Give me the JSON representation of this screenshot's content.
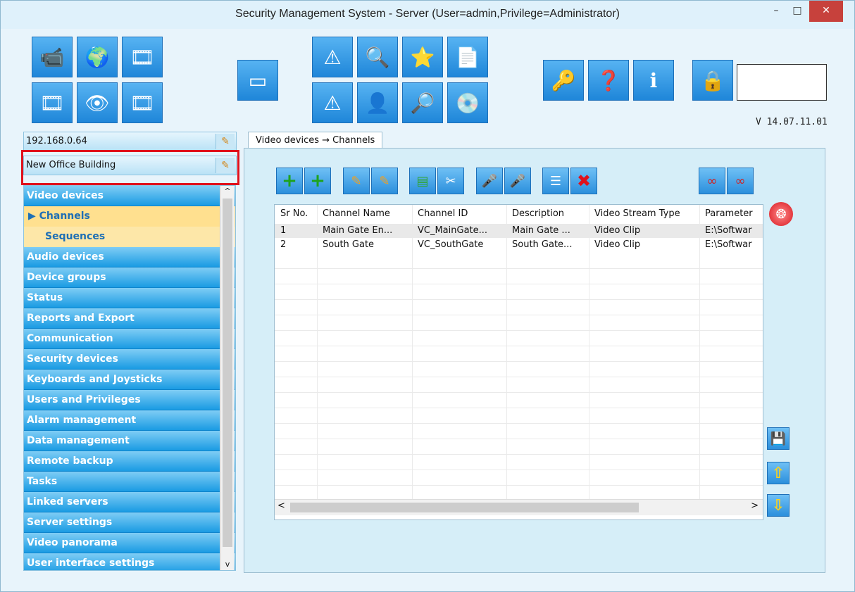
{
  "window": {
    "title": "Security Management System - Server (User=admin,Privilege=Administrator)",
    "minimize_glyph": "–",
    "maximize_glyph": "□",
    "close_glyph": "✕"
  },
  "toolbar": {
    "version": "V 14.07.11.01",
    "buttons": [
      {
        "icon": "camera-icon",
        "glyph": "📹"
      },
      {
        "icon": "globe-icon",
        "glyph": "🌍"
      },
      {
        "icon": "film-refresh-icon",
        "glyph": "🎞"
      },
      {
        "icon": "film-reel-icon",
        "glyph": "🎞"
      },
      {
        "icon": "eye-view-icon",
        "glyph": "👁"
      },
      {
        "icon": "film-export-icon",
        "glyph": "🎞"
      },
      {
        "icon": "windows-icon",
        "glyph": "▭"
      },
      {
        "icon": "warning-icon",
        "glyph": "⚠"
      },
      {
        "icon": "search-icon",
        "glyph": "🔍"
      },
      {
        "icon": "film-star-icon",
        "glyph": "⭐"
      },
      {
        "icon": "report-icon",
        "glyph": "📄"
      },
      {
        "icon": "alarm-warning-icon",
        "glyph": "⚠"
      },
      {
        "icon": "user-icon",
        "glyph": "👤"
      },
      {
        "icon": "film-search-icon",
        "glyph": "🔎"
      },
      {
        "icon": "disc-export-icon",
        "glyph": "💿"
      },
      {
        "icon": "key-icon",
        "glyph": "🔑"
      },
      {
        "icon": "help-document-icon",
        "glyph": "❓"
      },
      {
        "icon": "info-icon",
        "glyph": "ℹ"
      },
      {
        "icon": "lock-icon",
        "glyph": "🔒"
      }
    ]
  },
  "server": {
    "address": "192.168.0.64",
    "site_name": "New Office Building",
    "edit_glyph": "✎"
  },
  "nav": {
    "items": [
      {
        "label": "Video devices",
        "type": "group"
      },
      {
        "label": "▶ Channels",
        "type": "sub-selected"
      },
      {
        "label": "Sequences",
        "type": "sub"
      },
      {
        "label": "Audio devices",
        "type": "group"
      },
      {
        "label": "Device groups",
        "type": "group"
      },
      {
        "label": "Status",
        "type": "group"
      },
      {
        "label": "Reports and Export",
        "type": "group"
      },
      {
        "label": "Communication",
        "type": "group"
      },
      {
        "label": "Security devices",
        "type": "group"
      },
      {
        "label": "Keyboards and Joysticks",
        "type": "group"
      },
      {
        "label": "Users and Privileges",
        "type": "group"
      },
      {
        "label": "Alarm management",
        "type": "group"
      },
      {
        "label": "Data management",
        "type": "group"
      },
      {
        "label": "Remote backup",
        "type": "group"
      },
      {
        "label": "Tasks",
        "type": "group"
      },
      {
        "label": "Linked servers",
        "type": "group"
      },
      {
        "label": "Server settings",
        "type": "group"
      },
      {
        "label": "Video panorama",
        "type": "group"
      },
      {
        "label": "User interface settings",
        "type": "group"
      }
    ],
    "scroll_up": "^",
    "scroll_down": "v"
  },
  "tab": {
    "label": "Video devices → Channels"
  },
  "channel_toolbar": {
    "buttons": [
      {
        "icon": "add-icon",
        "glyph": "+"
      },
      {
        "icon": "add-multiple-icon",
        "glyph": "+"
      },
      {
        "icon": "edit-icon",
        "glyph": "✎"
      },
      {
        "icon": "edit-multiple-icon",
        "glyph": "✎"
      },
      {
        "icon": "database-icon",
        "glyph": "▤"
      },
      {
        "icon": "tools-icon",
        "glyph": "✂"
      },
      {
        "icon": "microphone-icon",
        "glyph": "🎤"
      },
      {
        "icon": "microphone-off-icon",
        "glyph": "🎤"
      },
      {
        "icon": "list-icon",
        "glyph": "☰"
      },
      {
        "icon": "delete-icon",
        "glyph": "✖"
      },
      {
        "icon": "link-add-icon",
        "glyph": "∞"
      },
      {
        "icon": "link-remove-icon",
        "glyph": "∞"
      }
    ]
  },
  "grid": {
    "columns": [
      "Sr No.",
      "Channel Name",
      "Channel ID",
      "Description",
      "Video Stream Type",
      "Parameter"
    ],
    "rows": [
      [
        "1",
        "Main Gate En...",
        "VC_MainGate...",
        "Main Gate ...",
        "Video Clip",
        "E:\\Softwar"
      ],
      [
        "2",
        "South Gate",
        "VC_SouthGate",
        "South Gate...",
        "Video Clip",
        "E:\\Softwar"
      ]
    ],
    "scroll_left": "<",
    "scroll_right": ">"
  },
  "side_buttons": {
    "record_glyph": "❂",
    "save_glyph": "💾",
    "up_glyph": "⇧",
    "down_glyph": "⇩"
  }
}
